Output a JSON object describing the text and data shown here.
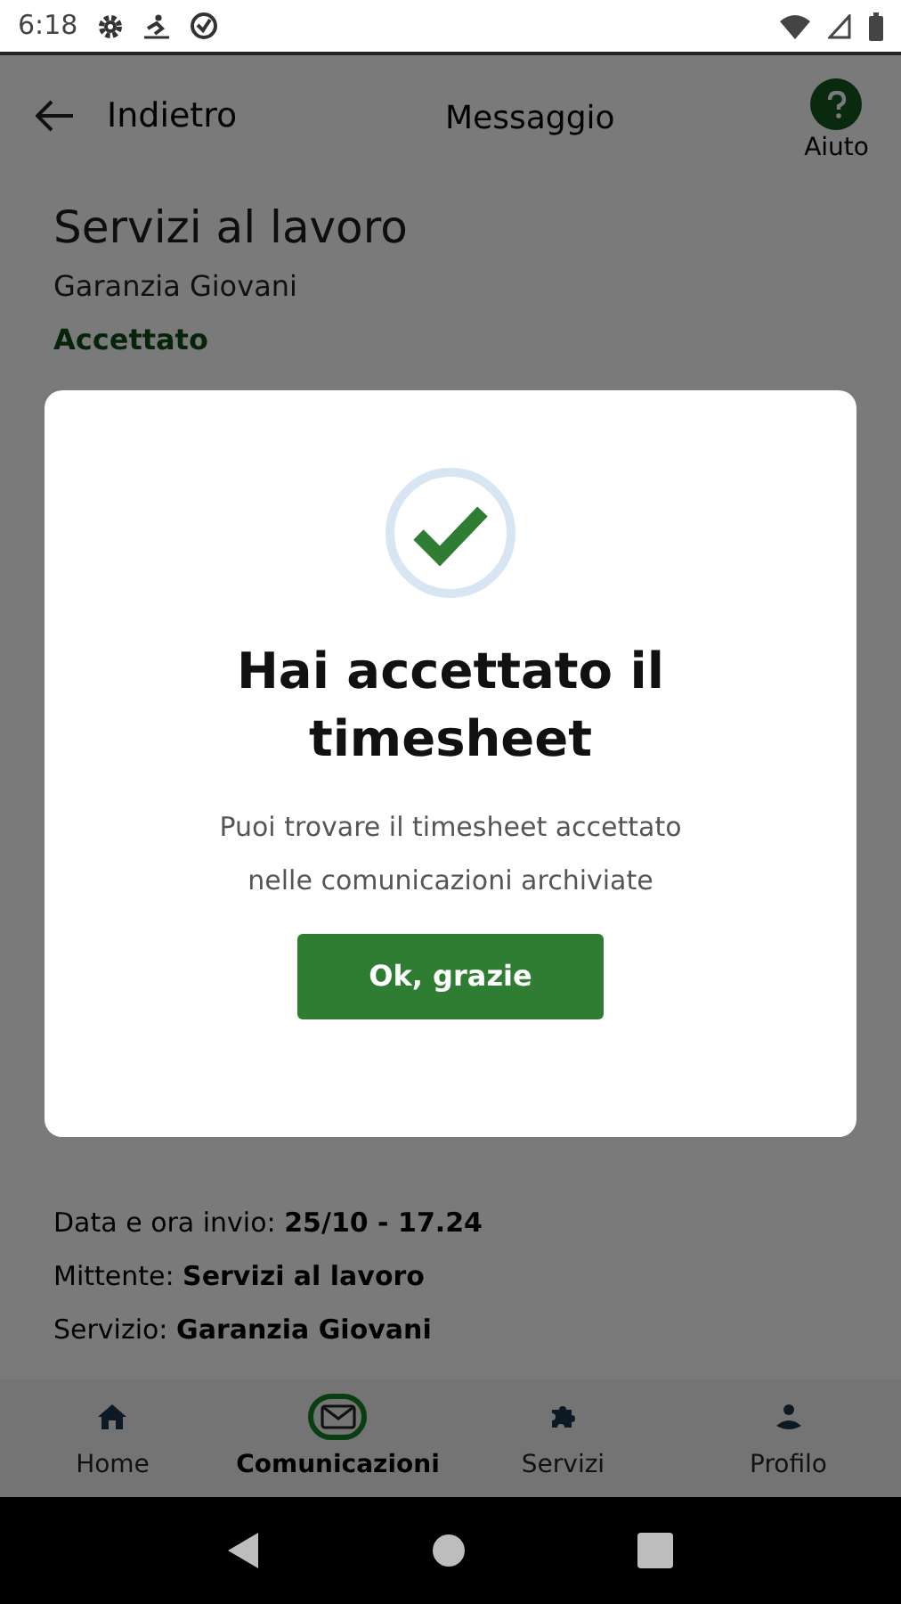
{
  "status_bar": {
    "time": "6:18"
  },
  "header": {
    "back_label": "Indietro",
    "title": "Messaggio",
    "help_label": "Aiuto"
  },
  "message": {
    "title": "Servizi al lavoro",
    "subtitle": "Garanzia Giovani",
    "status": "Accettato"
  },
  "dialog": {
    "title": "Hai accettato il timesheet",
    "body": "Puoi trovare il timesheet accettato nelle comunicazioni archiviate",
    "button": "Ok, grazie"
  },
  "details": [
    "Data e ora invio: **25/10 - 17.24**",
    "Mittente: **Servizi al lavoro**",
    "Servizio: **Garanzia Giovani**"
  ],
  "bottom_nav": [
    {
      "label": "Home",
      "kind": "home",
      "selected": false
    },
    {
      "label": "Comunicazioni",
      "kind": "mail",
      "selected": true
    },
    {
      "label": "Servizi",
      "kind": "puzzle",
      "selected": false
    },
    {
      "label": "Profilo",
      "kind": "person",
      "selected": false
    }
  ]
}
